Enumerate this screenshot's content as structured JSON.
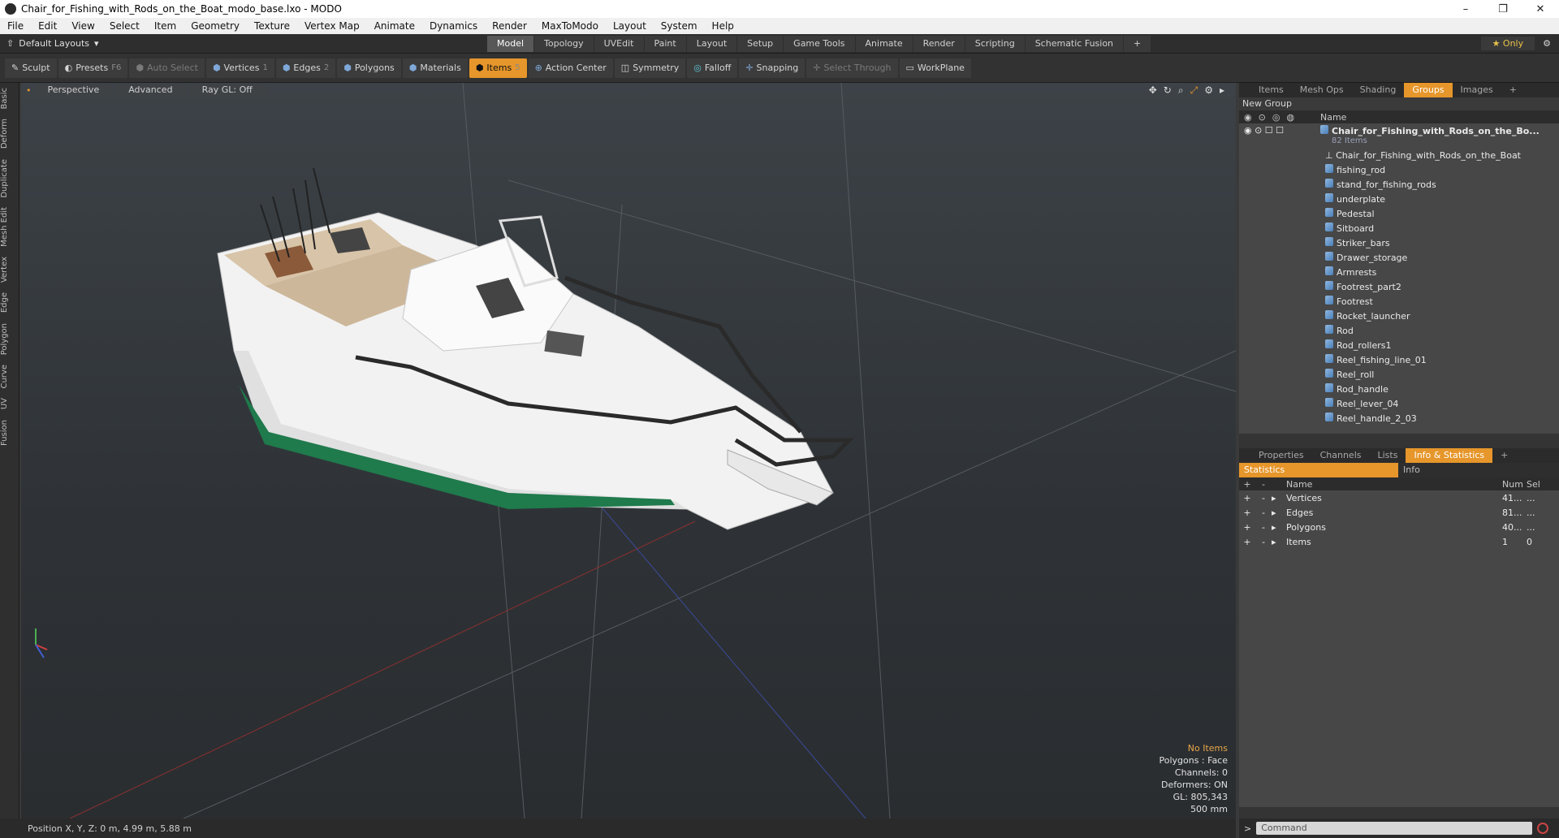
{
  "window": {
    "title": "Chair_for_Fishing_with_Rods_on_the_Boat_modo_base.lxo - MODO",
    "controls": [
      "–",
      "❐",
      "✕"
    ]
  },
  "menu": [
    "File",
    "Edit",
    "View",
    "Select",
    "Item",
    "Geometry",
    "Texture",
    "Vertex Map",
    "Animate",
    "Dynamics",
    "Render",
    "MaxToModo",
    "Layout",
    "System",
    "Help"
  ],
  "layoutbar": {
    "layout_selector": "Default Layouts",
    "tabs": [
      "Model",
      "Topology",
      "UVEdit",
      "Paint",
      "Layout",
      "Setup",
      "Game Tools",
      "Animate",
      "Render",
      "Scripting",
      "Schematic Fusion"
    ],
    "active_tab": "Model",
    "only_label": "Only"
  },
  "toolbar": {
    "sculpt": "Sculpt",
    "presets": "Presets",
    "presets_key": "F6",
    "auto_select": "Auto Select",
    "vertices": "Vertices",
    "vertices_key": "1",
    "edges": "Edges",
    "edges_key": "2",
    "polygons": "Polygons",
    "materials": "Materials",
    "items": "Items",
    "items_key": "5",
    "action_center": "Action Center",
    "symmetry": "Symmetry",
    "falloff": "Falloff",
    "snapping": "Snapping",
    "select_through": "Select Through",
    "workplane": "WorkPlane"
  },
  "left_tabs": [
    "Basic",
    "Deform",
    "Duplicate",
    "Mesh Edit",
    "Vertex",
    "Edge",
    "Polygon",
    "Curve",
    "UV",
    "Fusion"
  ],
  "viewport": {
    "view_mode": "Perspective",
    "shading": "Advanced",
    "raygl": "Ray GL: Off",
    "info": {
      "selection": "No Items",
      "polygons": "Polygons : Face",
      "channels": "Channels: 0",
      "deformers": "Deformers: ON",
      "gl": "GL: 805,343",
      "scale": "500 mm"
    }
  },
  "statusbar": {
    "position": "Position X, Y, Z:  0 m, 4.99 m, 5.88 m"
  },
  "items_panel": {
    "tabs": [
      "Items",
      "Mesh Ops",
      "Shading",
      "Groups",
      "Images"
    ],
    "active_tab": "Groups",
    "new_group": "New Group",
    "name_header": "Name",
    "root": {
      "name": "Chair_for_Fishing_with_Rods_on_the_Bo...",
      "count": "82 Items"
    },
    "children": [
      "Chair_for_Fishing_with_Rods_on_the_Boat",
      "fishing_rod",
      "stand_for_fishing_rods",
      "underplate",
      "Pedestal",
      "Sitboard",
      "Striker_bars",
      "Drawer_storage",
      "Armrests",
      "Footrest_part2",
      "Footrest",
      "Rocket_launcher",
      "Rod",
      "Rod_rollers1",
      "Reel_fishing_line_01",
      "Reel_roll",
      "Rod_handle",
      "Reel_lever_04",
      "Reel_handle_2_03"
    ]
  },
  "stats_panel": {
    "tabs": [
      "Properties",
      "Channels",
      "Lists",
      "Info & Statistics"
    ],
    "active_tab": "Info & Statistics",
    "sub_tabs": [
      "Statistics",
      "Info"
    ],
    "headers": {
      "name": "Name",
      "num": "Num",
      "sel": "Sel"
    },
    "rows": [
      {
        "name": "Vertices",
        "num": "41...",
        "sel": "..."
      },
      {
        "name": "Edges",
        "num": "81...",
        "sel": "..."
      },
      {
        "name": "Polygons",
        "num": "40...",
        "sel": "..."
      },
      {
        "name": "Items",
        "num": "1",
        "sel": "0"
      }
    ]
  },
  "command": {
    "placeholder": "Command"
  },
  "colors": {
    "accent_orange": "#e6962a",
    "hull_green": "#1f7a4c",
    "viewport_bg": "#2e3236"
  }
}
